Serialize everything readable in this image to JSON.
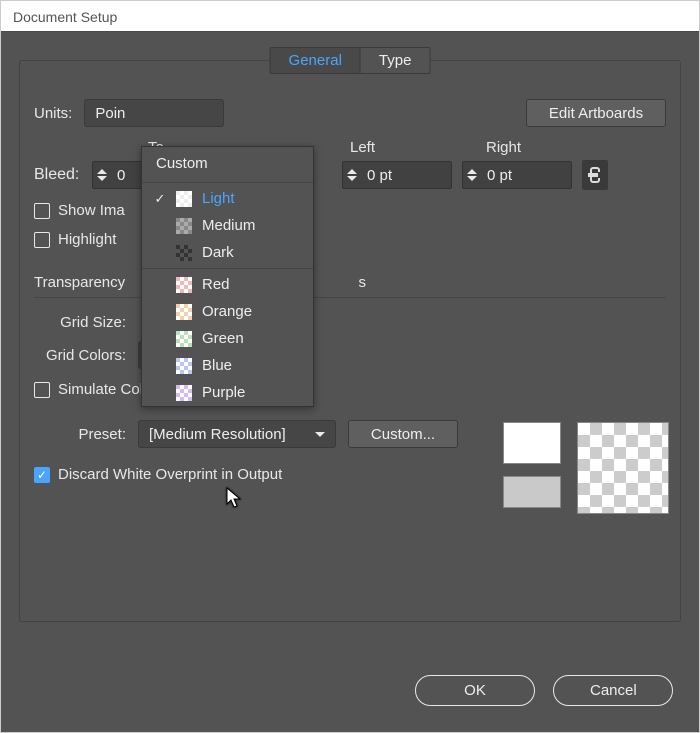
{
  "window": {
    "title": "Document Setup"
  },
  "tabs": {
    "general": "General",
    "type": "Type"
  },
  "units": {
    "label": "Units:",
    "value": "Poin"
  },
  "edit_artboards": "Edit Artboards",
  "bleed": {
    "label": "Bleed:",
    "top_label": "To",
    "left_label": "Left",
    "right_label": "Right",
    "top": "0",
    "left": "0 pt",
    "right": "0 pt"
  },
  "show_images": "Show Ima",
  "highlight": "Highlight",
  "transparency": {
    "title": "Transparency"
  },
  "grid_size": {
    "label": "Grid Size:"
  },
  "grid_colors": {
    "label": "Grid Colors:",
    "value": "Light"
  },
  "simulate": "Simulate Colored Paper",
  "preset": {
    "label": "Preset:",
    "value": "[Medium Resolution]",
    "custom_btn": "Custom..."
  },
  "discard": "Discard White Overprint in Output",
  "buttons": {
    "ok": "OK",
    "cancel": "Cancel"
  },
  "dropdown": {
    "title": "Custom",
    "items": [
      {
        "label": "Light",
        "swatch": "ck-light",
        "selected": true
      },
      {
        "label": "Medium",
        "swatch": "ck-med"
      },
      {
        "label": "Dark",
        "swatch": "ck-dark"
      },
      {
        "label": "Red",
        "swatch": "ck-red"
      },
      {
        "label": "Orange",
        "swatch": "ck-orange"
      },
      {
        "label": "Green",
        "swatch": "ck-green"
      },
      {
        "label": "Blue",
        "swatch": "ck-blue"
      },
      {
        "label": "Purple",
        "swatch": "ck-purple"
      }
    ]
  }
}
